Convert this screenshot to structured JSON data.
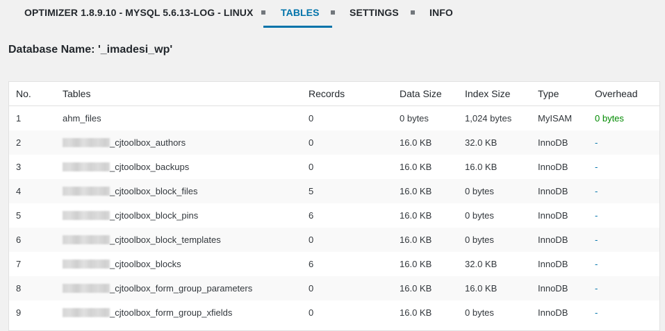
{
  "nav": {
    "title": "OPTIMIZER 1.8.9.10 - MYSQL 5.6.13-LOG - LINUX",
    "tabs": [
      {
        "label": "TABLES",
        "active": true
      },
      {
        "label": "SETTINGS",
        "active": false
      },
      {
        "label": "INFO",
        "active": false
      }
    ]
  },
  "database": {
    "label": "Database Name: '_imadesi_wp'"
  },
  "table": {
    "headers": [
      "No.",
      "Tables",
      "Records",
      "Data Size",
      "Index Size",
      "Type",
      "Overhead"
    ],
    "rows": [
      {
        "no": "1",
        "name": "ahm_files",
        "redacted": false,
        "records": "0",
        "data_size": "0 bytes",
        "index_size": "1,024 bytes",
        "type": "MyISAM",
        "overhead": "0 bytes"
      },
      {
        "no": "2",
        "name": "_cjtoolbox_authors",
        "redacted": true,
        "records": "0",
        "data_size": "16.0 KB",
        "index_size": "32.0 KB",
        "type": "InnoDB",
        "overhead": "-"
      },
      {
        "no": "3",
        "name": "_cjtoolbox_backups",
        "redacted": true,
        "records": "0",
        "data_size": "16.0 KB",
        "index_size": "16.0 KB",
        "type": "InnoDB",
        "overhead": "-"
      },
      {
        "no": "4",
        "name": "_cjtoolbox_block_files",
        "redacted": true,
        "records": "5",
        "data_size": "16.0 KB",
        "index_size": "0 bytes",
        "type": "InnoDB",
        "overhead": "-"
      },
      {
        "no": "5",
        "name": "_cjtoolbox_block_pins",
        "redacted": true,
        "records": "6",
        "data_size": "16.0 KB",
        "index_size": "0 bytes",
        "type": "InnoDB",
        "overhead": "-"
      },
      {
        "no": "6",
        "name": "_cjtoolbox_block_templates",
        "redacted": true,
        "records": "0",
        "data_size": "16.0 KB",
        "index_size": "0 bytes",
        "type": "InnoDB",
        "overhead": "-"
      },
      {
        "no": "7",
        "name": "_cjtoolbox_blocks",
        "redacted": true,
        "records": "6",
        "data_size": "16.0 KB",
        "index_size": "32.0 KB",
        "type": "InnoDB",
        "overhead": "-"
      },
      {
        "no": "8",
        "name": "_cjtoolbox_form_group_parameters",
        "redacted": true,
        "records": "0",
        "data_size": "16.0 KB",
        "index_size": "16.0 KB",
        "type": "InnoDB",
        "overhead": "-"
      },
      {
        "no": "9",
        "name": "_cjtoolbox_form_group_xfields",
        "redacted": true,
        "records": "0",
        "data_size": "16.0 KB",
        "index_size": "0 bytes",
        "type": "InnoDB",
        "overhead": "-"
      }
    ]
  },
  "colors": {
    "accent": "#0073aa",
    "overhead_zero": "#008a00",
    "background": "#f1f1f1"
  }
}
